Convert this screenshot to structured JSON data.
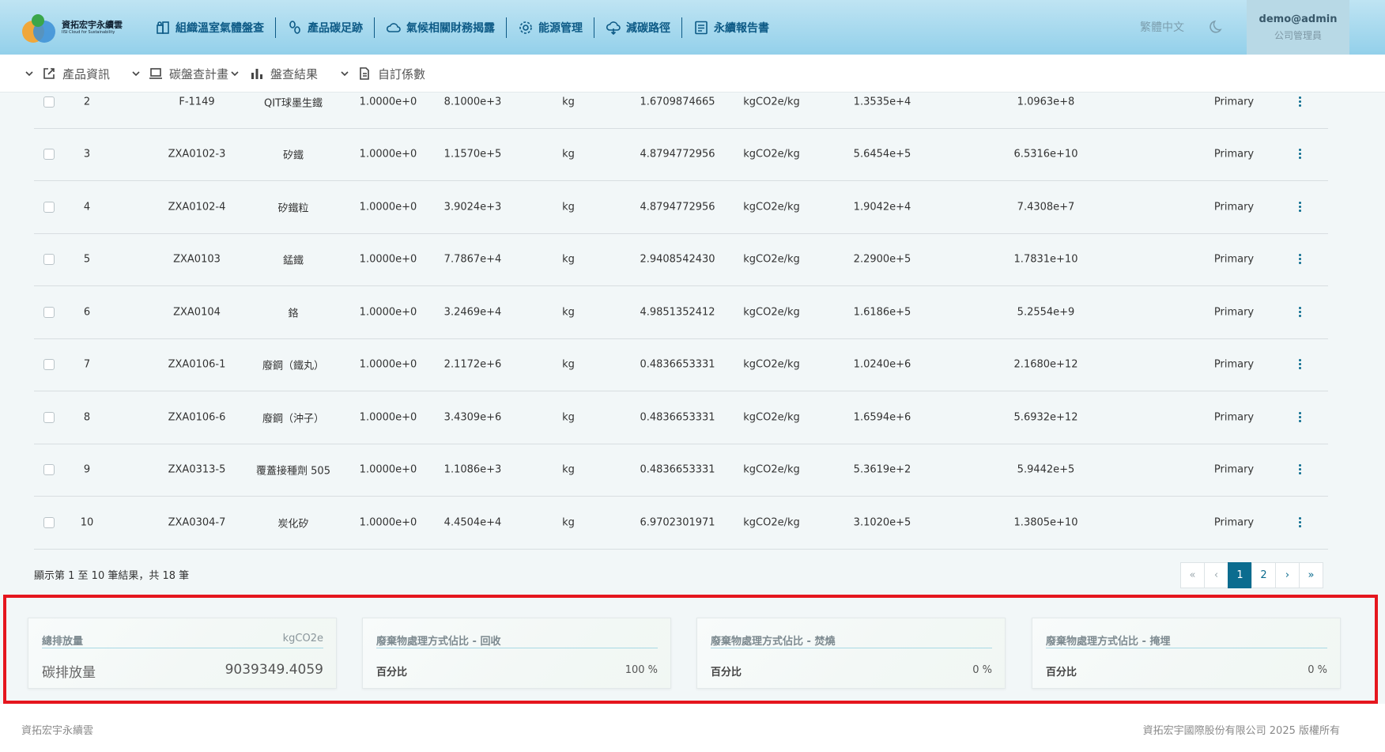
{
  "header": {
    "logo_text": "資拓宏宇永續雲",
    "logo_subtext": "IISI Cloud for Sustainability",
    "nav": [
      {
        "label": "組織溫室氣體盤查",
        "icon": "organization-icon"
      },
      {
        "label": "產品碳足跡",
        "icon": "footprint-icon"
      },
      {
        "label": "氣候相關財務揭露",
        "icon": "cloud-icon"
      },
      {
        "label": "能源管理",
        "icon": "gear-icon"
      },
      {
        "label": "減碳路徑",
        "icon": "cloud-down-icon"
      },
      {
        "label": "永續報告書",
        "icon": "report-icon"
      }
    ],
    "language": "繁體中文",
    "user_name": "demo@admin",
    "user_role": "公司管理員"
  },
  "subnav": {
    "items": [
      {
        "label": "產品資訊",
        "icon": "external-link-icon"
      },
      {
        "label": "碳盤查計畫",
        "icon": "laptop-icon"
      },
      {
        "label": "盤查結果",
        "icon": "bar-chart-icon"
      },
      {
        "label": "自訂係數",
        "icon": "document-icon"
      }
    ]
  },
  "table": {
    "rows": [
      {
        "no": "2",
        "code": "F-1149",
        "name": "QIT球墨生鐵",
        "factor": "1.0000e+0",
        "amount": "8.1000e+3",
        "unit": "kg",
        "coef": "1.6709874665",
        "coef_unit": "kgCO2e/kg",
        "emission": "1.3535e+4",
        "total": "1.0963e+8",
        "source": "Primary"
      },
      {
        "no": "3",
        "code": "ZXA0102-3",
        "name": "矽鐵",
        "factor": "1.0000e+0",
        "amount": "1.1570e+5",
        "unit": "kg",
        "coef": "4.8794772956",
        "coef_unit": "kgCO2e/kg",
        "emission": "5.6454e+5",
        "total": "6.5316e+10",
        "source": "Primary"
      },
      {
        "no": "4",
        "code": "ZXA0102-4",
        "name": "矽鐵粒",
        "factor": "1.0000e+0",
        "amount": "3.9024e+3",
        "unit": "kg",
        "coef": "4.8794772956",
        "coef_unit": "kgCO2e/kg",
        "emission": "1.9042e+4",
        "total": "7.4308e+7",
        "source": "Primary"
      },
      {
        "no": "5",
        "code": "ZXA0103",
        "name": "錳鐵",
        "factor": "1.0000e+0",
        "amount": "7.7867e+4",
        "unit": "kg",
        "coef": "2.9408542430",
        "coef_unit": "kgCO2e/kg",
        "emission": "2.2900e+5",
        "total": "1.7831e+10",
        "source": "Primary"
      },
      {
        "no": "6",
        "code": "ZXA0104",
        "name": "鉻",
        "factor": "1.0000e+0",
        "amount": "3.2469e+4",
        "unit": "kg",
        "coef": "4.9851352412",
        "coef_unit": "kgCO2e/kg",
        "emission": "1.6186e+5",
        "total": "5.2554e+9",
        "source": "Primary"
      },
      {
        "no": "7",
        "code": "ZXA0106-1",
        "name": "廢鋼（鐵丸）",
        "factor": "1.0000e+0",
        "amount": "2.1172e+6",
        "unit": "kg",
        "coef": "0.4836653331",
        "coef_unit": "kgCO2e/kg",
        "emission": "1.0240e+6",
        "total": "2.1680e+12",
        "source": "Primary"
      },
      {
        "no": "8",
        "code": "ZXA0106-6",
        "name": "廢鋼（沖子）",
        "factor": "1.0000e+0",
        "amount": "3.4309e+6",
        "unit": "kg",
        "coef": "0.4836653331",
        "coef_unit": "kgCO2e/kg",
        "emission": "1.6594e+6",
        "total": "5.6932e+12",
        "source": "Primary"
      },
      {
        "no": "9",
        "code": "ZXA0313-5",
        "name": "覆蓋接種劑 505",
        "factor": "1.0000e+0",
        "amount": "1.1086e+3",
        "unit": "kg",
        "coef": "0.4836653331",
        "coef_unit": "kgCO2e/kg",
        "emission": "5.3619e+2",
        "total": "5.9442e+5",
        "source": "Primary"
      },
      {
        "no": "10",
        "code": "ZXA0304-7",
        "name": "炭化矽",
        "factor": "1.0000e+0",
        "amount": "4.4504e+4",
        "unit": "kg",
        "coef": "6.9702301971",
        "coef_unit": "kgCO2e/kg",
        "emission": "3.1020e+5",
        "total": "1.3805e+10",
        "source": "Primary"
      }
    ]
  },
  "pagination": {
    "summary": "顯示第 1 至 10 筆結果，共 18 筆",
    "first": "«",
    "prev": "‹",
    "pages": [
      "1",
      "2"
    ],
    "current_page": "1",
    "next": "›",
    "last": "»"
  },
  "summary_cards": [
    {
      "title": "總排放量",
      "unit": "kgCO2e",
      "label": "碳排放量",
      "value": "9039349.4059"
    },
    {
      "title": "廢棄物處理方式佔比 - 回收",
      "unit": "",
      "label": "百分比",
      "value": "100 %"
    },
    {
      "title": "廢棄物處理方式佔比 - 焚燒",
      "unit": "",
      "label": "百分比",
      "value": "0 %"
    },
    {
      "title": "廢棄物處理方式佔比 - 掩埋",
      "unit": "",
      "label": "百分比",
      "value": "0 %"
    }
  ],
  "footer": {
    "left": "資拓宏宇永續雲",
    "right": "資拓宏宇國際股份有限公司 2025 版權所有"
  },
  "colors": {
    "brand": "#0c6c8f",
    "nav_text": "#0d5a86",
    "highlight_border": "#e5161e"
  }
}
